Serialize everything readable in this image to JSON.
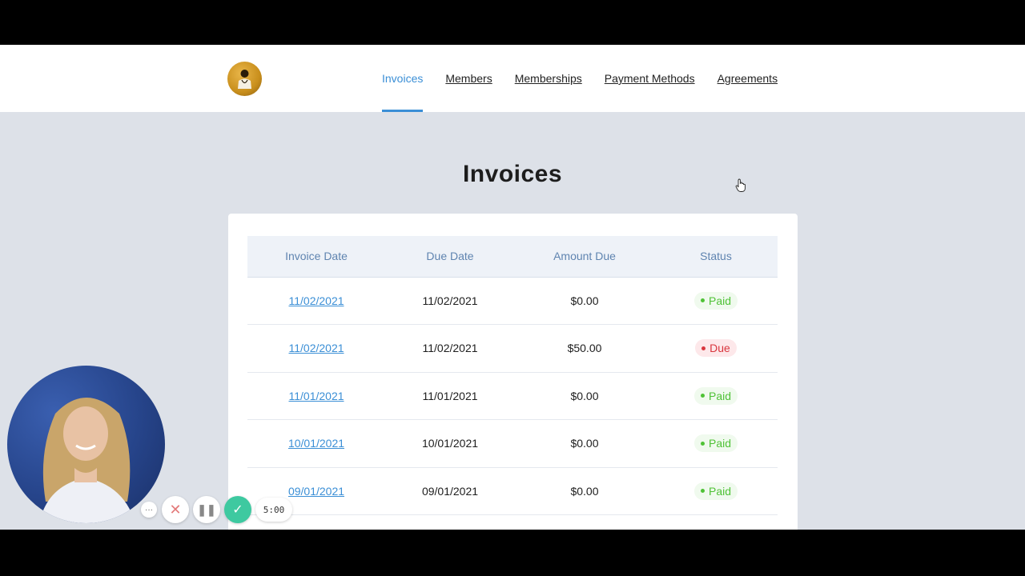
{
  "brand": {
    "logo_icon": "doctor-avatar-icon",
    "accent": "#3b8fd6"
  },
  "nav": {
    "items": [
      {
        "label": "Invoices",
        "active": true
      },
      {
        "label": "Members",
        "active": false
      },
      {
        "label": "Memberships",
        "active": false
      },
      {
        "label": "Payment Methods",
        "active": false
      },
      {
        "label": "Agreements",
        "active": false
      }
    ]
  },
  "page": {
    "title": "Invoices"
  },
  "table": {
    "headers": [
      "Invoice Date",
      "Due Date",
      "Amount Due",
      "Status"
    ],
    "rows": [
      {
        "invoice_date": "11/02/2021",
        "due_date": "11/02/2021",
        "amount": "$0.00",
        "status": "Paid"
      },
      {
        "invoice_date": "11/02/2021",
        "due_date": "11/02/2021",
        "amount": "$50.00",
        "status": "Due"
      },
      {
        "invoice_date": "11/01/2021",
        "due_date": "11/01/2021",
        "amount": "$0.00",
        "status": "Paid"
      },
      {
        "invoice_date": "10/01/2021",
        "due_date": "10/01/2021",
        "amount": "$0.00",
        "status": "Paid"
      },
      {
        "invoice_date": "09/01/2021",
        "due_date": "09/01/2021",
        "amount": "$0.00",
        "status": "Paid"
      }
    ],
    "status_colors": {
      "Paid": "#4fc236",
      "Due": "#d9363e"
    }
  },
  "recorder": {
    "more_label": "···",
    "timer": "5:00",
    "icons": [
      "more-icon",
      "close-icon",
      "pause-icon",
      "check-icon"
    ]
  }
}
